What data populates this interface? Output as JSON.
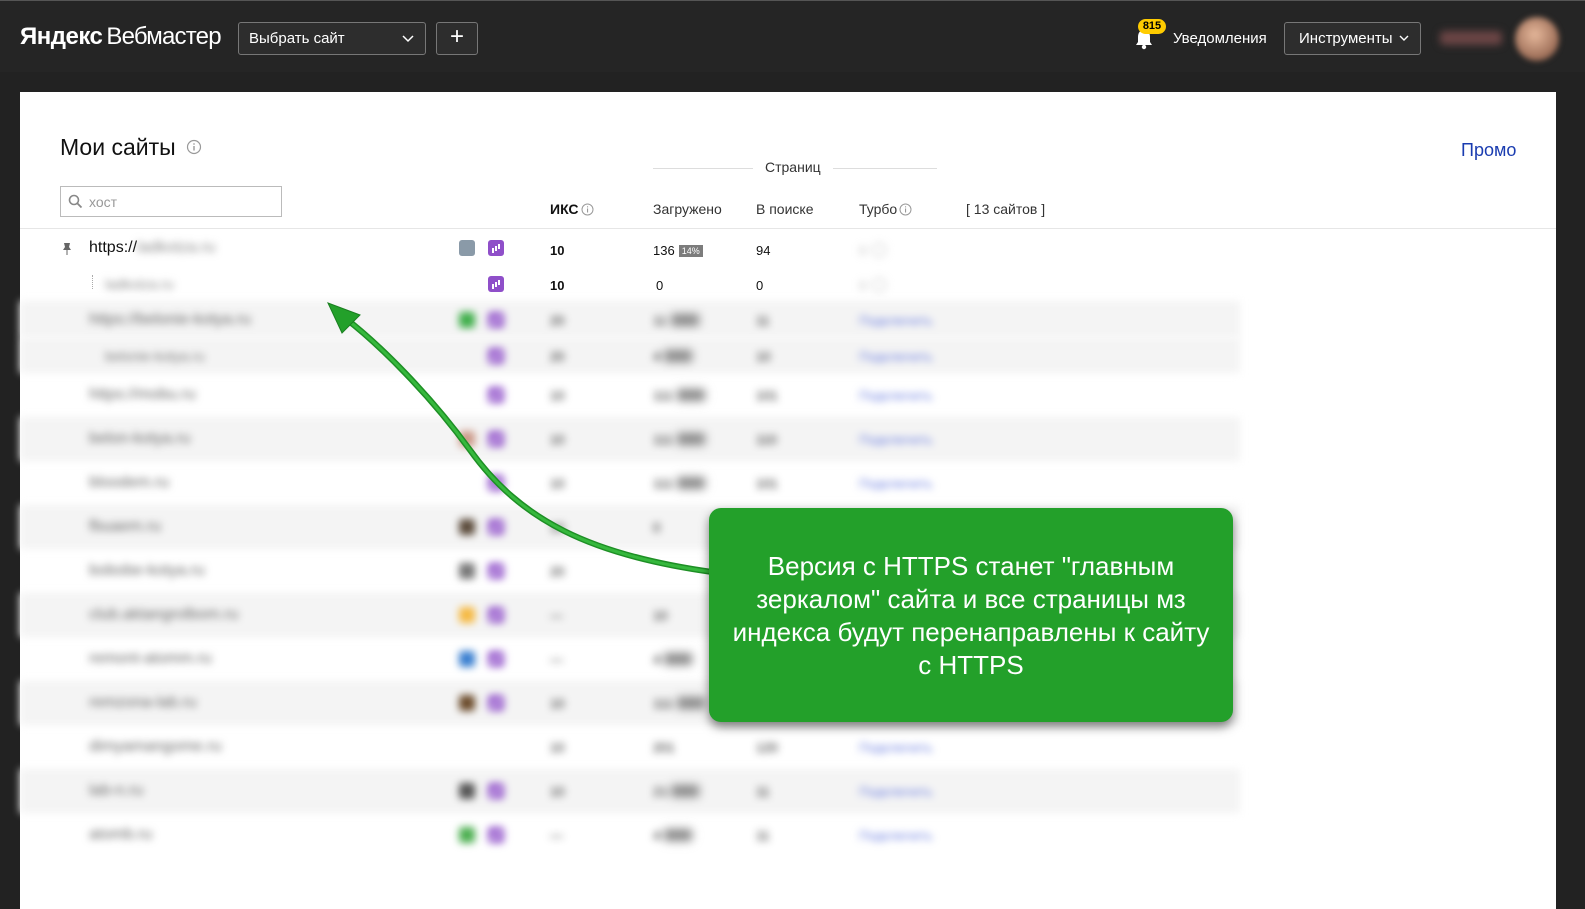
{
  "header": {
    "logo_brand": "Яндекс",
    "logo_product": "Вебмастер",
    "site_select_label": "Выбрать сайт",
    "add_label": "+",
    "notifications_count": "815",
    "notifications_label": "Уведомления",
    "tools_label": "Инструменты"
  },
  "main": {
    "title": "Мои сайты",
    "promo_label": "Промо",
    "search_placeholder": "хост",
    "columns": {
      "iks": "ИКС",
      "pages_group": "Страниц",
      "loaded": "Загружено",
      "in_search": "В поиске",
      "turbo": "Турбо",
      "count": "[ 13 сайтов ]"
    },
    "rows": [
      {
        "host": "https://",
        "host_hidden": "ladkotza.ru",
        "iks": "10",
        "loaded": "136",
        "loaded_pct": "14%",
        "in_search": "94",
        "turbo": "0"
      },
      {
        "host": "ladkotza.ru",
        "iks": "10",
        "loaded": "0",
        "in_search": "0",
        "turbo": "0"
      },
      {
        "host": "https://belonie-kotya.ru",
        "iks": "20",
        "loaded": "11",
        "in_search": "11",
        "turbo": "Подключить"
      },
      {
        "host": "belonie-kotya.ru",
        "iks": "20",
        "loaded": "4",
        "in_search": "10",
        "turbo": "Подключить"
      },
      {
        "host": "https://mobu.ru",
        "iks": "10",
        "loaded": "111",
        "in_search": "101",
        "turbo": "Подключить"
      },
      {
        "host": "belon-kotya.ru",
        "iks": "10",
        "loaded": "111",
        "in_search": "110",
        "turbo": "Подключить"
      },
      {
        "host": "bloodem.ru",
        "iks": "10",
        "loaded": "111",
        "in_search": "101",
        "turbo": "Подключить"
      },
      {
        "host": "fbuaem.ru",
        "iks": "10",
        "loaded": "0",
        "in_search": "",
        "turbo": ""
      },
      {
        "host": "bobobe-kotya.ru",
        "iks": "20",
        "loaded": "",
        "in_search": "",
        "turbo": ""
      },
      {
        "host": "club.aktangrolbom.ru",
        "iks": "—",
        "loaded": "10",
        "in_search": "",
        "turbo": ""
      },
      {
        "host": "remont-atomm.ru",
        "iks": "—",
        "loaded": "4",
        "in_search": "",
        "turbo": ""
      },
      {
        "host": "remzona-lab.ru",
        "iks": "10",
        "loaded": "111",
        "in_search": "",
        "turbo": ""
      },
      {
        "host": "dimyamangome.ru",
        "iks": "10",
        "loaded": "201",
        "in_search": "120",
        "turbo": "Подключить"
      },
      {
        "host": "lab-n.ru",
        "iks": "10",
        "loaded": "21",
        "in_search": "11",
        "turbo": "Подключить"
      },
      {
        "host": "atomb.ru",
        "iks": "—",
        "loaded": "4",
        "in_search": "11",
        "turbo": "Подключить"
      }
    ]
  },
  "callout": {
    "text": "Версия с HTTPS станет \"главным зеркалом\" сайта и все страницы мз индекса будут перенаправлены к сайту с HTTPS"
  },
  "colors": {
    "header_bg": "#252525",
    "callout_bg": "#23a02a",
    "badge": "#ffcc00",
    "link": "#1a3cb0",
    "metrika_icon": "#8f4fc9"
  }
}
